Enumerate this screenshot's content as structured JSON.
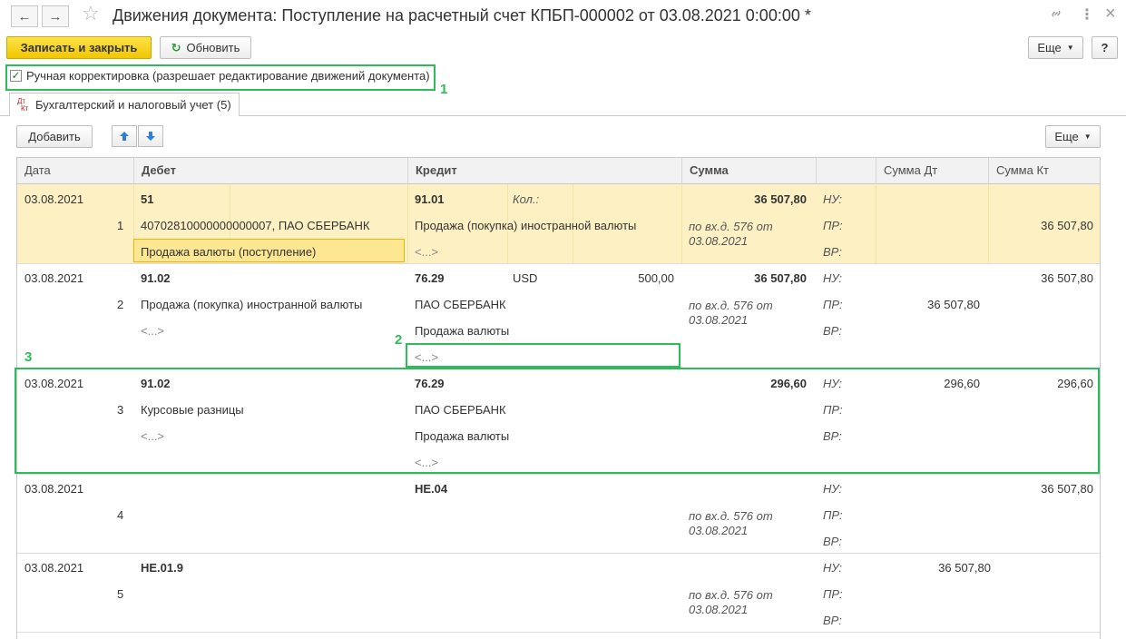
{
  "window": {
    "title": "Движения документа: Поступление на расчетный счет КПБП-000002 от 03.08.2021 0:00:00 *",
    "back_icon": "←",
    "forward_icon": "→",
    "favorite_icon": "☆",
    "link_icon": "🔗",
    "more_icon": "⋮",
    "close_icon": "×"
  },
  "toolbar": {
    "save_close": "Записать и закрыть",
    "refresh": "Обновить",
    "refresh_icon": "↻",
    "more": "Еще",
    "help": "?"
  },
  "manual_correction": {
    "checked": true,
    "label": "Ручная корректировка (разрешает редактирование движений документа)"
  },
  "tabs": [
    {
      "label": "Бухгалтерский и налоговый учет (5)",
      "icon_top": "Дт",
      "icon_bottom": "Кт"
    }
  ],
  "table_toolbar": {
    "add": "Добавить",
    "up_icon": "🡅",
    "down_icon": "🡇",
    "more": "Еще"
  },
  "table": {
    "columns": [
      "Дата",
      "Дебет",
      "Кредит",
      "Сумма",
      "",
      "Сумма Дт",
      "Сумма Кт"
    ],
    "records": [
      {
        "date": "03.08.2021",
        "num": "1",
        "selected": true,
        "debit_account": "51",
        "debit_sub1": "40702810000000000007, ПАО СБЕРБАНК",
        "debit_sub2": "Продажа валюты (поступление)",
        "debit_sub3": "",
        "credit_account": "91.01",
        "credit_qty_label": "Кол.:",
        "credit_currency": "",
        "credit_currency_amount": "",
        "credit_sub1": "Продажа (покупка) иностранной валюты",
        "credit_sub2": "<...>",
        "credit_sub3": "",
        "amount": "36 507,80",
        "content": "по вх.д. 576 от 03.08.2021",
        "nu": "НУ:",
        "pr": "ПР:",
        "vr": "ВР:",
        "nu_dt": "",
        "nu_kt": "",
        "pr_dt": "",
        "pr_kt": "36 507,80",
        "vr_dt": "",
        "vr_kt": ""
      },
      {
        "date": "03.08.2021",
        "num": "2",
        "selected": false,
        "debit_account": "91.02",
        "debit_sub1": "Продажа (покупка) иностранной валюты",
        "debit_sub2": "<...>",
        "debit_sub3": "",
        "credit_account": "76.29",
        "credit_qty_label": "",
        "credit_currency": "USD",
        "credit_currency_amount": "500,00",
        "credit_sub1": "ПАО СБЕРБАНК",
        "credit_sub2": "Продажа валюты",
        "credit_sub3": "<...>",
        "amount": "36 507,80",
        "content": "по вх.д. 576 от 03.08.2021",
        "nu": "НУ:",
        "pr": "ПР:",
        "vr": "ВР:",
        "nu_dt": "",
        "nu_kt": "36 507,80",
        "pr_dt": "36 507,80",
        "pr_kt": "",
        "vr_dt": "",
        "vr_kt": ""
      },
      {
        "date": "03.08.2021",
        "num": "3",
        "selected": false,
        "debit_account": "91.02",
        "debit_sub1": "Курсовые разницы",
        "debit_sub2": "<...>",
        "debit_sub3": "",
        "credit_account": "76.29",
        "credit_qty_label": "",
        "credit_currency": "",
        "credit_currency_amount": "",
        "credit_sub1": "ПАО СБЕРБАНК",
        "credit_sub2": "Продажа валюты",
        "credit_sub3": "<...>",
        "amount": "296,60",
        "content": "",
        "nu": "НУ:",
        "pr": "ПР:",
        "vr": "ВР:",
        "nu_dt": "296,60",
        "nu_kt": "296,60",
        "pr_dt": "",
        "pr_kt": "",
        "vr_dt": "",
        "vr_kt": ""
      },
      {
        "date": "03.08.2021",
        "num": "4",
        "selected": false,
        "debit_account": "",
        "debit_sub1": "",
        "debit_sub2": "",
        "debit_sub3": "",
        "credit_account": "НЕ.04",
        "credit_qty_label": "",
        "credit_currency": "",
        "credit_currency_amount": "",
        "credit_sub1": "",
        "credit_sub2": "",
        "credit_sub3": "",
        "amount": "",
        "content": "по вх.д. 576 от 03.08.2021",
        "nu": "НУ:",
        "pr": "ПР:",
        "vr": "ВР:",
        "nu_dt": "",
        "nu_kt": "36 507,80",
        "pr_dt": "",
        "pr_kt": "",
        "vr_dt": "",
        "vr_kt": ""
      },
      {
        "date": "03.08.2021",
        "num": "5",
        "selected": false,
        "debit_account": "НЕ.01.9",
        "debit_sub1": "",
        "debit_sub2": "",
        "debit_sub3": "",
        "credit_account": "",
        "credit_qty_label": "",
        "credit_currency": "",
        "credit_currency_amount": "",
        "credit_sub1": "",
        "credit_sub2": "",
        "credit_sub3": "",
        "amount": "",
        "content": "по вх.д. 576 от 03.08.2021",
        "nu": "НУ:",
        "pr": "ПР:",
        "vr": "ВР:",
        "nu_dt": "36 507,80",
        "nu_kt": "",
        "pr_dt": "",
        "pr_kt": "",
        "vr_dt": "",
        "vr_kt": ""
      }
    ]
  },
  "annotations": {
    "n1": "1",
    "n2": "2",
    "n3": "3",
    "color": "#2dbb5c"
  },
  "colors": {
    "primary_button": "#f2c600",
    "selected_row": "#fdf1c4",
    "selected_cell": "#fde792"
  }
}
